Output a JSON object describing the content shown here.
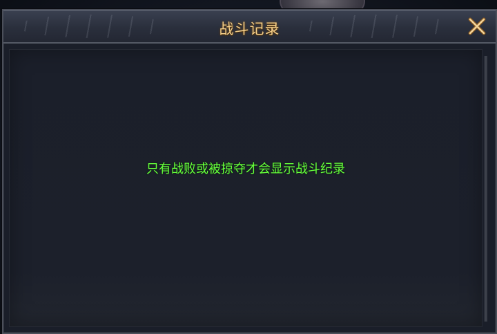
{
  "dialog": {
    "title": "战斗记录",
    "close_icon": "close-icon",
    "empty_message": "只有战败或被掠夺才会显示战斗纪录"
  },
  "colors": {
    "title": "#f4cf8a",
    "message": "#66ff3c",
    "panel_bg": "#1a1e29",
    "close_icon": "#f2d49a"
  }
}
